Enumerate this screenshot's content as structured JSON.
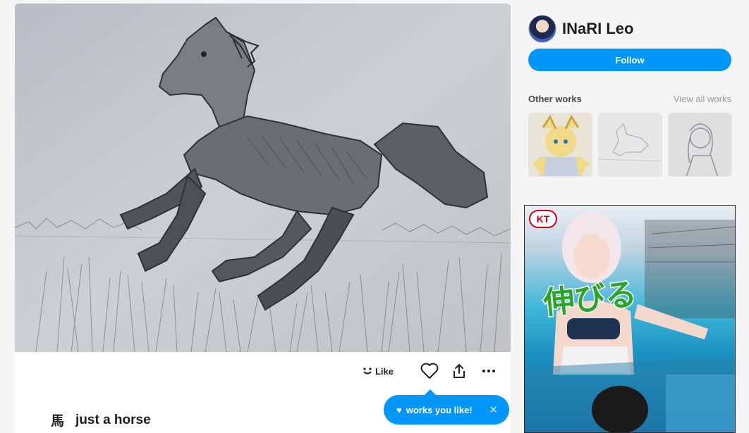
{
  "artwork": {
    "title": "just a horse",
    "title_jp": "馬"
  },
  "actions": {
    "like_label": "Like",
    "heart_icon": "heart-outline-icon",
    "share_icon": "share-icon",
    "more_icon": "more-horizontal-icon"
  },
  "toast": {
    "text": "works you like!",
    "close": "✕"
  },
  "profile": {
    "name": "INaRI Leo",
    "follow_label": "Follow"
  },
  "other_works": {
    "label": "Other works",
    "view_all": "View all works"
  },
  "ad": {
    "logo": "KT",
    "text": "伸びる"
  },
  "colors": {
    "accent": "#0096fa",
    "page_bg": "#f5f5f5"
  }
}
